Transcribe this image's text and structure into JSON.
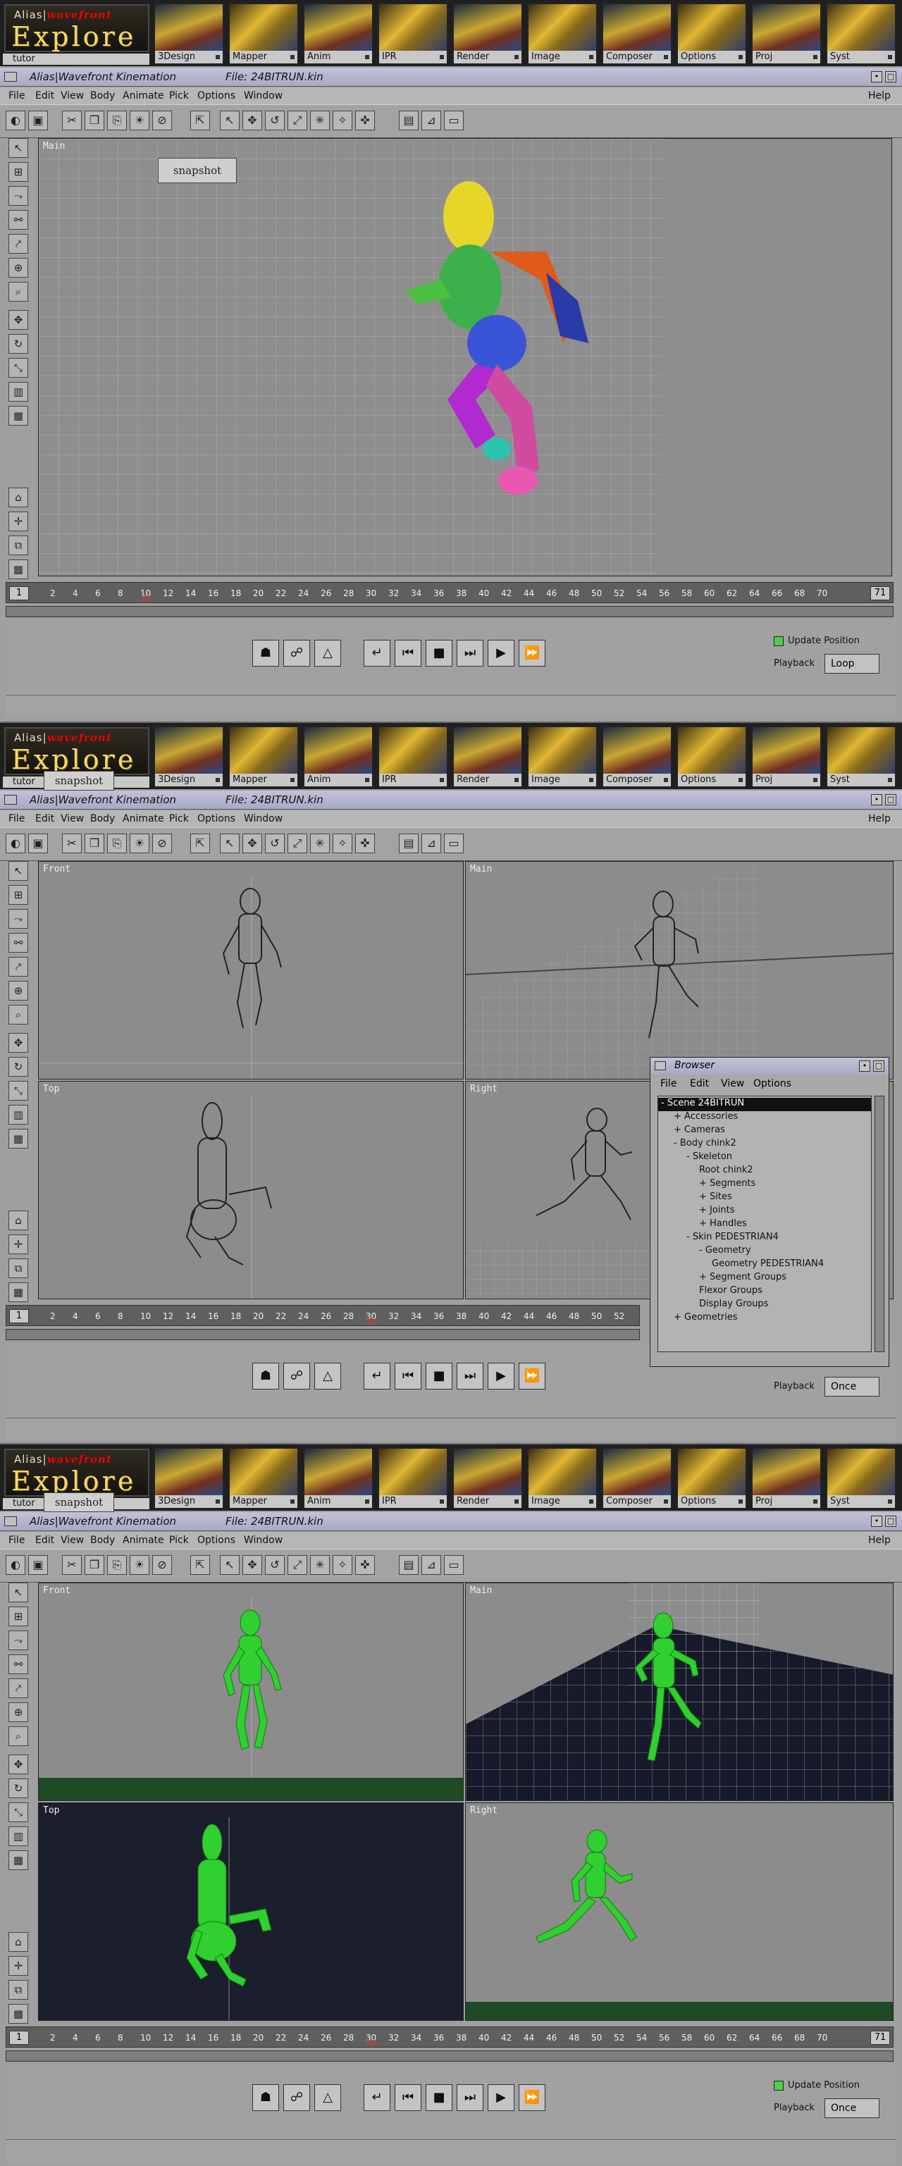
{
  "app": {
    "brand": "Alias|wavefront",
    "brand_left": "Alias",
    "brand_right": "wavefront",
    "logo_word": "Explore",
    "user": "tutor",
    "window_title": "Alias|Wavefront Kinemation",
    "file_title": "File: 24BITRUN.kin"
  },
  "modules": [
    "3Design",
    "Mapper",
    "Anim",
    "IPR",
    "Render",
    "Image",
    "Composer",
    "Options",
    "Proj",
    "Syst"
  ],
  "menus": [
    "File",
    "Edit",
    "View",
    "Body",
    "Animate",
    "Pick",
    "Options",
    "Window"
  ],
  "help": "Help",
  "snapshot_label": "snapshot",
  "viewports": {
    "main": "Main",
    "front": "Front",
    "top": "Top",
    "right": "Right"
  },
  "timeline": {
    "start": "1",
    "end": "71",
    "ticks": [
      "2",
      "4",
      "6",
      "8",
      "10",
      "12",
      "14",
      "16",
      "18",
      "20",
      "22",
      "24",
      "26",
      "28",
      "30",
      "32",
      "34",
      "36",
      "38",
      "40",
      "42",
      "44",
      "46",
      "48",
      "50",
      "52",
      "54",
      "56",
      "58",
      "60",
      "62",
      "64",
      "66",
      "68",
      "70"
    ],
    "ticks_short": [
      "2",
      "4",
      "6",
      "8",
      "10",
      "12",
      "14",
      "16",
      "18",
      "20",
      "22",
      "24",
      "26",
      "28",
      "30",
      "32",
      "34",
      "36",
      "38",
      "40",
      "42",
      "44",
      "46",
      "48",
      "50",
      "52"
    ],
    "current_1": "10",
    "current_2": "30",
    "current_3": "30"
  },
  "bottom": {
    "update_label": "Update Position",
    "playback_label": "Playback",
    "playback_1": "Loop",
    "playback_2": "Once",
    "playback_3": "Once"
  },
  "browser": {
    "title": "Browser",
    "menu": [
      "File",
      "Edit",
      "View",
      "Options"
    ],
    "tree": [
      {
        "label": "- Scene 24BITRUN",
        "indent": 0,
        "selected": true
      },
      {
        "label": "+ Accessories",
        "indent": 1
      },
      {
        "label": "+ Cameras",
        "indent": 1
      },
      {
        "label": "- Body chink2",
        "indent": 1
      },
      {
        "label": "- Skeleton",
        "indent": 2
      },
      {
        "label": "Root chink2",
        "indent": 3
      },
      {
        "label": "+ Segments",
        "indent": 3
      },
      {
        "label": "+ Sites",
        "indent": 3
      },
      {
        "label": "+ Joints",
        "indent": 3
      },
      {
        "label": "+ Handles",
        "indent": 3
      },
      {
        "label": "- Skin PEDESTRIAN4",
        "indent": 2
      },
      {
        "label": "- Geometry",
        "indent": 3
      },
      {
        "label": "Geometry PEDESTRIAN4",
        "indent": 4
      },
      {
        "label": "+ Segment Groups",
        "indent": 3
      },
      {
        "label": "Flexor Groups",
        "indent": 3
      },
      {
        "label": "Display Groups",
        "indent": 3
      },
      {
        "label": "+ Geometries",
        "indent": 1
      }
    ]
  }
}
